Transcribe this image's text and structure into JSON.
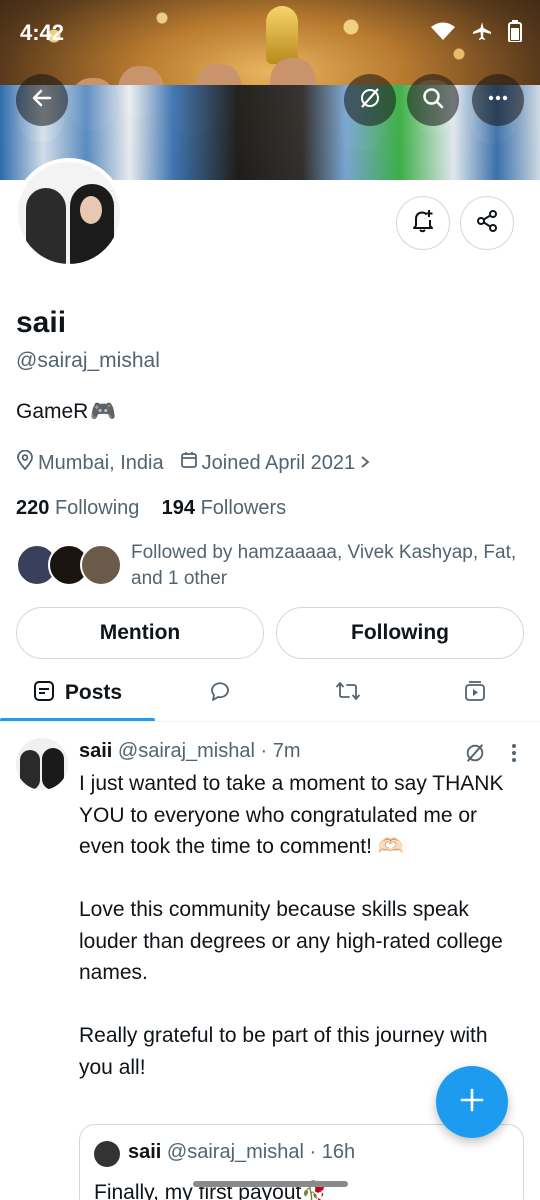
{
  "status_bar": {
    "time": "4:42"
  },
  "profile": {
    "name": "saii",
    "handle": "@sairaj_mishal",
    "bio": "GameR",
    "bio_emoji": "🎮",
    "location": "Mumbai, India",
    "joined": "Joined April 2021",
    "following_count": "220",
    "following_label": "Following",
    "followers_count": "194",
    "followers_label": "Followers",
    "followed_by": "Followed by hamzaaaaa, Vivek Kashyap, Fat, and 1 other"
  },
  "actions": {
    "mention": "Mention",
    "following": "Following"
  },
  "tabs": [
    {
      "label": "Posts",
      "selected": true
    }
  ],
  "post": {
    "author": "saii",
    "handle": "@sairaj_mishal",
    "time": "· 7m",
    "text": "I just wanted to take a moment to say THANK YOU to everyone who congratulated me or even took the time to comment! 🫶🏻\n\nLove this community because skills speak louder than degrees or any high-rated college names.\n\nReally grateful to be part of this journey with you all!",
    "quote": {
      "author": "saii",
      "handle": "@sairaj_mishal",
      "time": "· 16h",
      "text": "Finally, my first payout🥀"
    }
  },
  "colors": {
    "accent": "#1d9bf0",
    "text": "#0f1419",
    "secondary": "#536471",
    "border": "#cfd9de"
  },
  "icons": [
    "back-arrow-icon",
    "grok-icon",
    "search-icon",
    "more-icon",
    "notification-add-icon",
    "share-icon",
    "location-icon",
    "calendar-icon",
    "chevron-right-icon",
    "reply-icon",
    "repost-icon",
    "media-icon",
    "plus-icon"
  ]
}
